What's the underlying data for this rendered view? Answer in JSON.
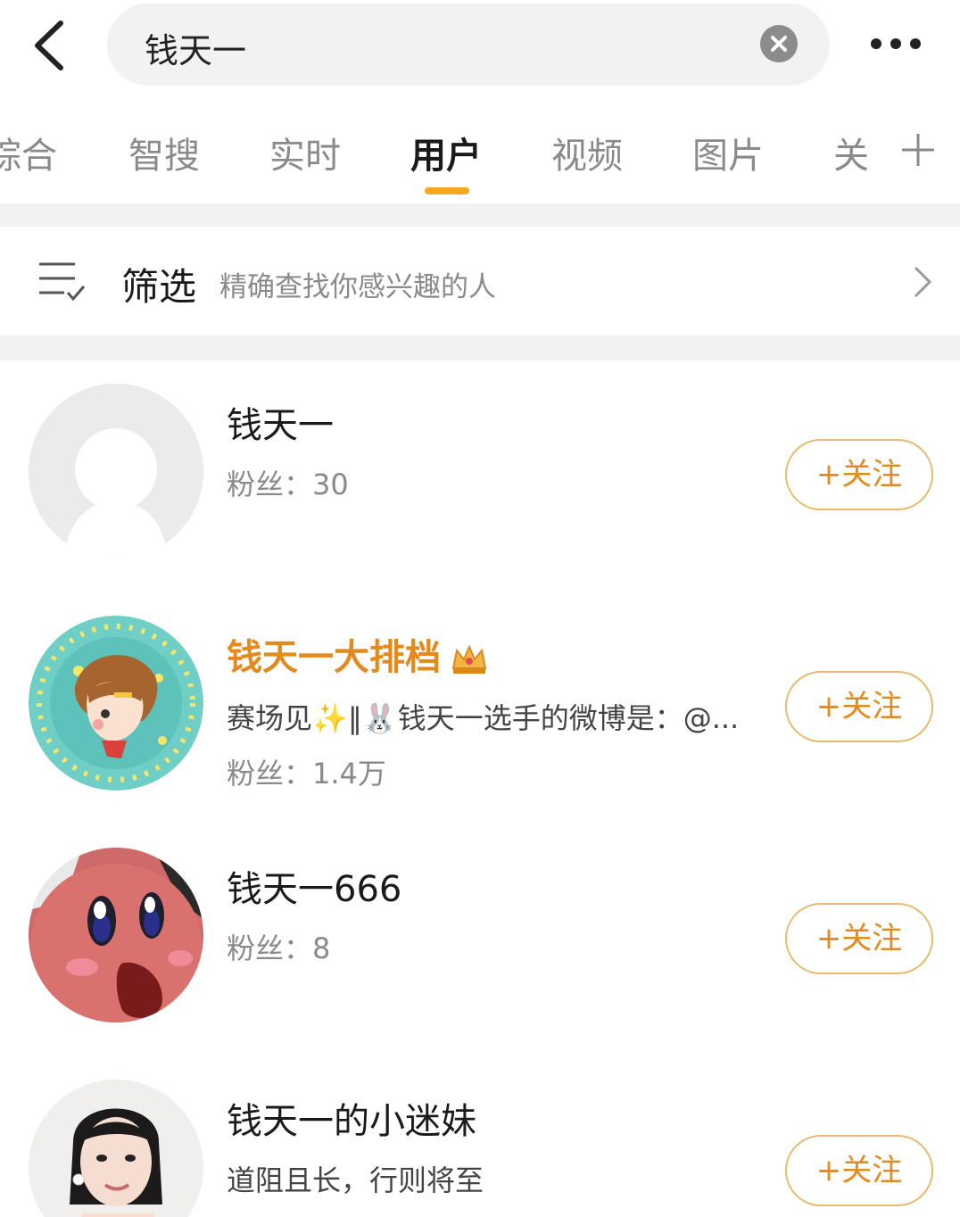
{
  "header": {
    "search_value": "钱天一",
    "back_icon": "chevron-left-icon",
    "clear_icon": "close-circle-icon",
    "more_icon": "more-dots-icon"
  },
  "tabs": [
    {
      "label": "综合",
      "active": false
    },
    {
      "label": "智搜",
      "active": false
    },
    {
      "label": "实时",
      "active": false
    },
    {
      "label": "用户",
      "active": true
    },
    {
      "label": "视频",
      "active": false
    },
    {
      "label": "图片",
      "active": false
    },
    {
      "label": "关",
      "active": false
    }
  ],
  "filter": {
    "label": "筛选",
    "hint": "精确查找你感兴趣的人"
  },
  "users": [
    {
      "name": "钱天一",
      "desc": "",
      "fans_label": "粉丝：",
      "fans": "30",
      "follow_label": "+关注"
    },
    {
      "name": "钱天一大排档",
      "desc": "赛场见✨‖🐰钱天一选手的微博是：@...",
      "fans_label": "粉丝：",
      "fans": "1.4万",
      "follow_label": "+关注"
    },
    {
      "name": "钱天一666",
      "desc": "",
      "fans_label": "粉丝：",
      "fans": "8",
      "follow_label": "+关注"
    },
    {
      "name": "钱天一的小迷妹",
      "desc": "道阻且长，行则将至",
      "fans_label": "",
      "fans": "",
      "follow_label": "+关注"
    }
  ],
  "colors": {
    "accent": "#f5a623",
    "follow": "#e38a1d",
    "band": "#f2f2f2"
  }
}
